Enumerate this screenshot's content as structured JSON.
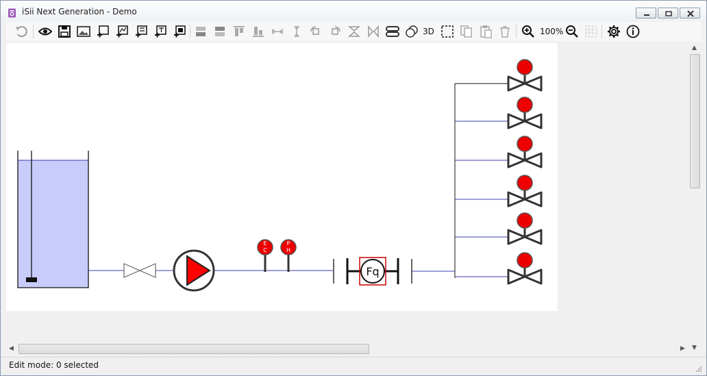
{
  "window": {
    "title": "iSii Next Generation - Demo"
  },
  "toolbar": {
    "zoom_level": "100%",
    "view_3d_label": "3D"
  },
  "diagram": {
    "sensor_ec_label_1": "E",
    "sensor_ec_label_2": "C",
    "sensor_ph_label_1": "P",
    "sensor_ph_label_2": "H",
    "flowmeter_label": "Fq",
    "colors": {
      "tank_fill": "#c8ccfa",
      "pipe": "#3b3fae",
      "pump_red": "#ff0000",
      "valve_indicator_red": "#ee0000"
    }
  },
  "status": {
    "text": "Edit mode: 0 selected"
  }
}
